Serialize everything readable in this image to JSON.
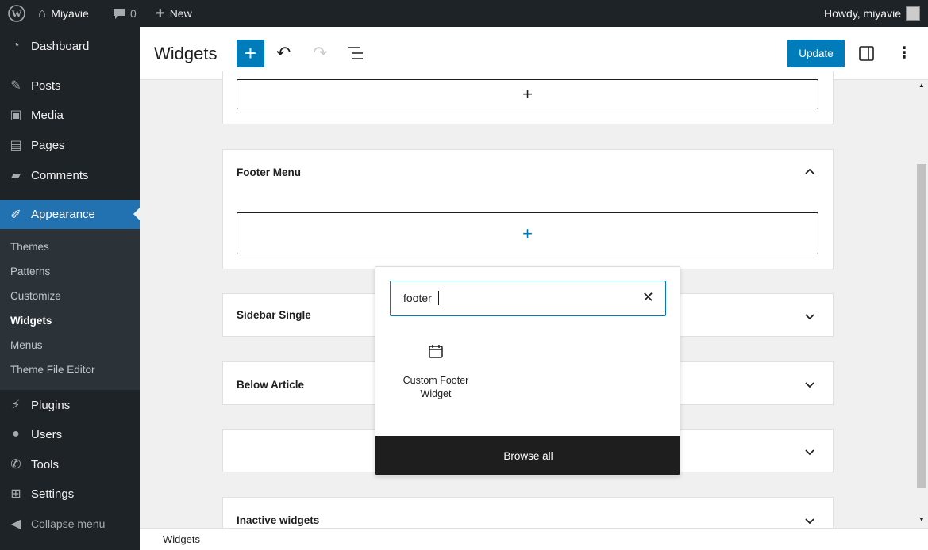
{
  "adminbar": {
    "site": "Miyavie",
    "comments": "0",
    "new": "New",
    "howdy": "Howdy, miyavie"
  },
  "sidebar": {
    "items": [
      {
        "label": "Dashboard",
        "icon": "dashboard-icon"
      },
      {
        "label": "Posts",
        "icon": "pin-icon"
      },
      {
        "label": "Media",
        "icon": "media-icon"
      },
      {
        "label": "Pages",
        "icon": "pages-icon"
      },
      {
        "label": "Comments",
        "icon": "comment-icon"
      },
      {
        "label": "Appearance",
        "icon": "brush-icon"
      },
      {
        "label": "Plugins",
        "icon": "plugin-icon"
      },
      {
        "label": "Users",
        "icon": "users-icon"
      },
      {
        "label": "Tools",
        "icon": "wrench-icon"
      },
      {
        "label": "Settings",
        "icon": "settings-icon"
      },
      {
        "label": "Collapse menu",
        "icon": "collapse-icon"
      }
    ],
    "submenu": [
      "Themes",
      "Patterns",
      "Customize",
      "Widgets",
      "Menus",
      "Theme File Editor"
    ],
    "current_sub": "Widgets"
  },
  "header": {
    "title": "Widgets",
    "update": "Update",
    "accent": "#007cba"
  },
  "panels": {
    "footer_menu": "Footer Menu",
    "sidebar_single": "Sidebar Single",
    "below_article": "Below Article",
    "inactive": "Inactive widgets"
  },
  "inserter": {
    "search_value": "footer",
    "result": "Custom Footer Widget",
    "browse_all": "Browse all"
  },
  "footer": {
    "breadcrumb": "Widgets"
  }
}
